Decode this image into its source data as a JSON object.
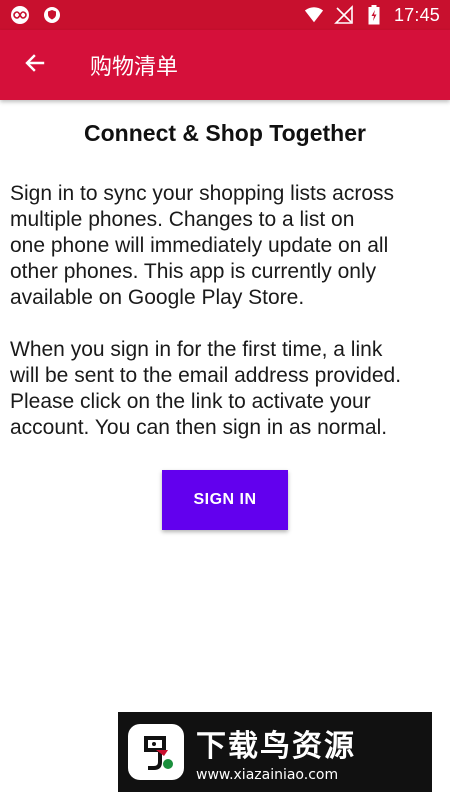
{
  "status_bar": {
    "time": "17:45",
    "icons": [
      "infinity-icon",
      "shield-icon",
      "wifi-icon",
      "no-signal-icon",
      "battery-icon"
    ]
  },
  "app_bar": {
    "title": "购物清单",
    "back_icon": "arrow-left-icon"
  },
  "main": {
    "heading": "Connect & Shop Together",
    "paragraph_1": "Sign in to sync your shopping lists across\nmultiple phones. Changes to a list on\none phone will immediately update on all\nother phones. This app is currently only\navailable on Google Play Store.",
    "paragraph_2": "When you sign in for the first time, a link\nwill be sent to the email address provided.\nPlease click on the link to activate your\naccount. You can then sign in as normal.",
    "signin_label": "SIGN IN"
  },
  "watermark": {
    "brand": "下载鸟资源",
    "url": "www.xiazainiao.com"
  },
  "colors": {
    "status_bar": "#c8102e",
    "app_bar": "#d5103a",
    "button": "#6200ee"
  }
}
